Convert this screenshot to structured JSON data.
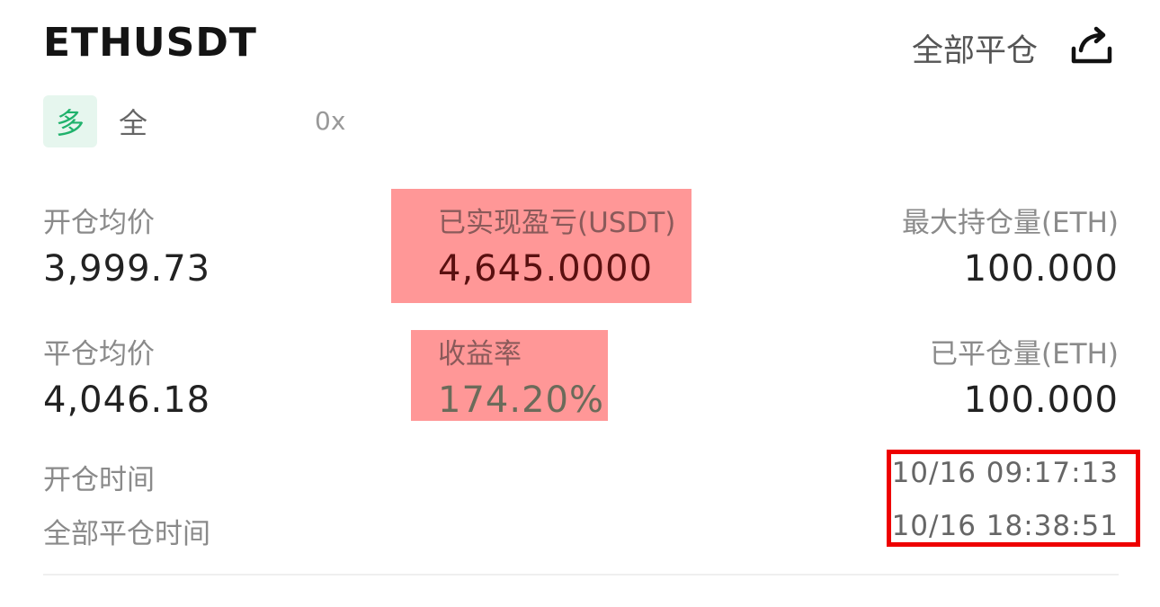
{
  "header": {
    "symbol": "ETHUSDT",
    "close_all_label": "全部平仓"
  },
  "tags": {
    "side": "多",
    "margin_mode": "全",
    "leverage": "0x"
  },
  "stats": {
    "open_avg_label": "开仓均价",
    "open_avg_value": "3,999.73",
    "realized_pnl_label": "已实现盈亏(USDT)",
    "realized_pnl_value": "4,645.0000",
    "max_position_label": "最大持仓量(ETH)",
    "max_position_value": "100.000",
    "close_avg_label": "平仓均价",
    "close_avg_value": "4,046.18",
    "roi_label": "收益率",
    "roi_value": "174.20%",
    "closed_amount_label": "已平仓量(ETH)",
    "closed_amount_value": "100.000"
  },
  "times": {
    "open_time_label": "开仓时间",
    "open_time_value": "10/16 09:17:13",
    "close_time_label": "全部平仓时间",
    "close_time_value": "10/16 18:38:51"
  },
  "colors": {
    "long_green": "#20b26c",
    "highlight": "#ff9797",
    "box_red": "#ee0000"
  }
}
